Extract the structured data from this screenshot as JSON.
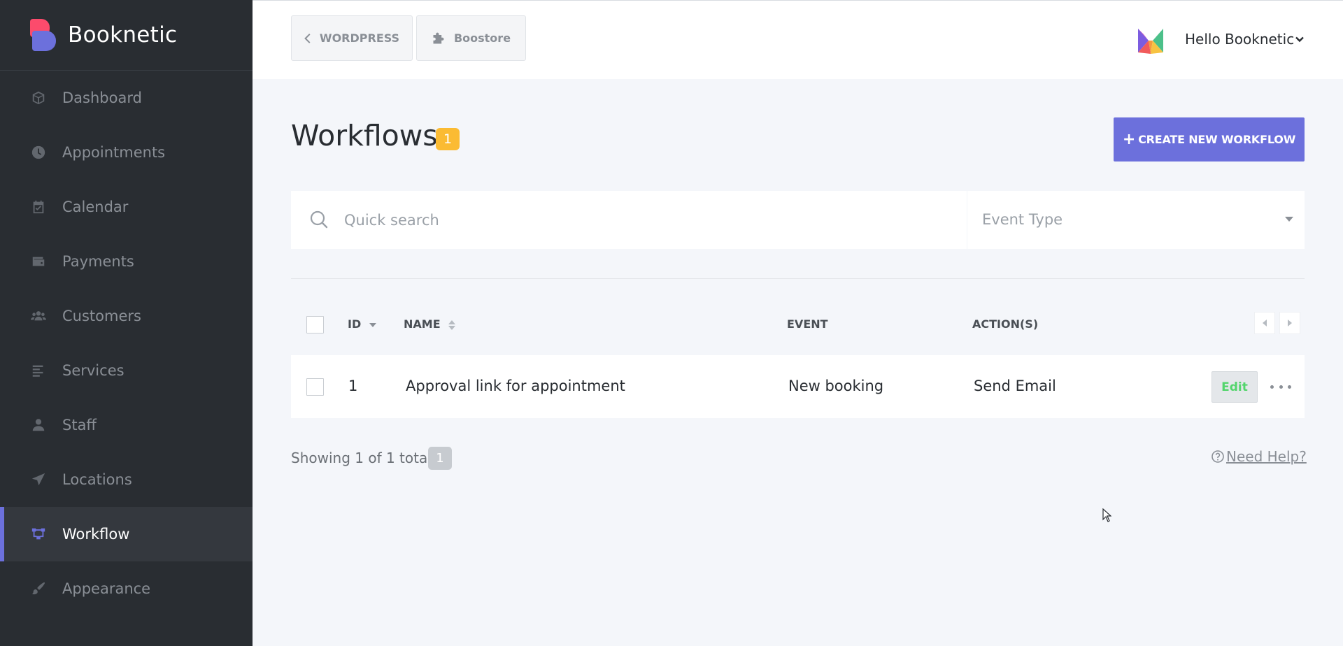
{
  "brand": {
    "name": "Booknetic"
  },
  "sidebar": {
    "items": [
      {
        "label": "Dashboard",
        "icon": "cube-icon"
      },
      {
        "label": "Appointments",
        "icon": "clock-icon"
      },
      {
        "label": "Calendar",
        "icon": "calendar-icon"
      },
      {
        "label": "Payments",
        "icon": "wallet-icon"
      },
      {
        "label": "Customers",
        "icon": "users-icon"
      },
      {
        "label": "Services",
        "icon": "list-icon"
      },
      {
        "label": "Staff",
        "icon": "user-icon"
      },
      {
        "label": "Locations",
        "icon": "location-arrow-icon"
      },
      {
        "label": "Workflow",
        "icon": "workflow-icon",
        "active": true
      },
      {
        "label": "Appearance",
        "icon": "brush-icon"
      }
    ]
  },
  "topbar": {
    "wordpress_label": "WORDPRESS",
    "boostore_label": "Boostore",
    "user_greeting": "Hello Booknetic"
  },
  "main": {
    "title": "Workflows",
    "count_badge": "1",
    "create_button": "CREATE NEW WORKFLOW",
    "search": {
      "placeholder": "Quick search",
      "value": ""
    },
    "event_filter": {
      "placeholder": "Event Type"
    },
    "table": {
      "columns": [
        "ID",
        "NAME",
        "EVENT",
        "ACTION(S)"
      ],
      "rows": [
        {
          "id": "1",
          "name": "Approval link for appointment",
          "event": "New booking",
          "actions": "Send Email",
          "edit_label": "Edit"
        }
      ]
    },
    "footer": {
      "total_text": "Showing 1 of 1 total",
      "page": "1",
      "help_label": "Need Help?"
    }
  },
  "colors": {
    "sidebar_bg": "#292d32",
    "accent": "#6c70dc",
    "badge": "#fbbb33",
    "edit_text": "#53d56c",
    "page_bg": "#f4f6fa"
  }
}
